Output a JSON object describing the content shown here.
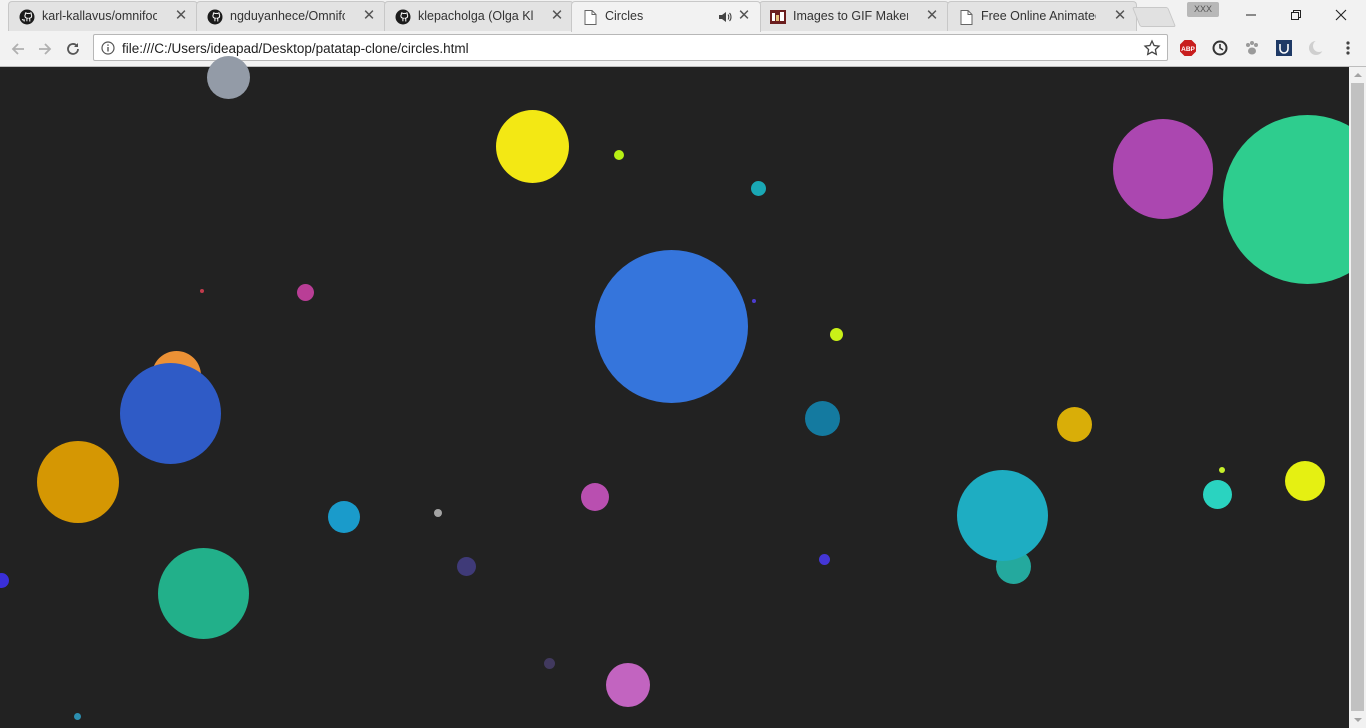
{
  "tabs": [
    {
      "title": "karl-kallavus/omnifood",
      "icon": "github-icon",
      "active": false
    },
    {
      "title": "ngduyanhece/Omnifood",
      "icon": "github-icon",
      "active": false
    },
    {
      "title": "klepacholga (Olga Klepa",
      "icon": "github-icon",
      "active": false
    },
    {
      "title": "Circles",
      "icon": "page-icon",
      "active": true,
      "audio": true
    },
    {
      "title": "Images to GIF Maker - I",
      "icon": "gif-maker-icon",
      "active": false
    },
    {
      "title": "Free Online Animated G",
      "icon": "page-icon",
      "active": false
    }
  ],
  "window": {
    "profile_label": "XXX",
    "minimize_icon": "minimize-icon",
    "restore_icon": "restore-icon",
    "close_icon": "close-icon"
  },
  "toolbar": {
    "url": "file:///C:/Users/ideapad/Desktop/patatap-clone/circles.html",
    "extensions": [
      "adblock-icon",
      "sync-icon",
      "paw-icon",
      "vpn-icon",
      "moon-icon"
    ]
  },
  "canvas": {
    "background": "#222222",
    "circles": [
      {
        "color": "#939ba7",
        "size": "large"
      },
      {
        "color": "#f3e814",
        "size": "large"
      },
      {
        "color": "#b7f014",
        "size": "tiny"
      },
      {
        "color": "#1aa8b5",
        "size": "small"
      },
      {
        "color": "#ab47b0",
        "size": "large"
      },
      {
        "color": "#2ecd8e",
        "size": "huge"
      },
      {
        "color": "#b93e96",
        "size": "small"
      },
      {
        "color": "#3575dc",
        "size": "huge"
      },
      {
        "color": "#c9f018",
        "size": "tiny"
      },
      {
        "color": "#ec9135",
        "size": "medium"
      },
      {
        "color": "#2f5bc6",
        "size": "large"
      },
      {
        "color": "#d59703",
        "size": "large"
      },
      {
        "color": "#147aa0",
        "size": "medium"
      },
      {
        "color": "#d9ae08",
        "size": "medium"
      },
      {
        "color": "#1a9bcb",
        "size": "medium"
      },
      {
        "color": "#b94fb0",
        "size": "small"
      },
      {
        "color": "#a4a4a4",
        "size": "tiny"
      },
      {
        "color": "#24a99e",
        "size": "medium"
      },
      {
        "color": "#1eadc2",
        "size": "large"
      },
      {
        "color": "#2ad3c0",
        "size": "small"
      },
      {
        "color": "#e5f012",
        "size": "medium"
      },
      {
        "color": "#c6f02a",
        "size": "tiny"
      },
      {
        "color": "#22b08a",
        "size": "large"
      },
      {
        "color": "#3f3a78",
        "size": "small"
      },
      {
        "color": "#4436d6",
        "size": "tiny"
      },
      {
        "color": "#3a2fd8",
        "size": "small"
      },
      {
        "color": "#c264c0",
        "size": "medium"
      },
      {
        "color": "#41395e",
        "size": "tiny"
      },
      {
        "color": "#2c8fb0",
        "size": "tiny"
      },
      {
        "color": "#c13b4c",
        "size": "tiny"
      },
      {
        "color": "#4d3cd0",
        "size": "tiny"
      }
    ]
  }
}
